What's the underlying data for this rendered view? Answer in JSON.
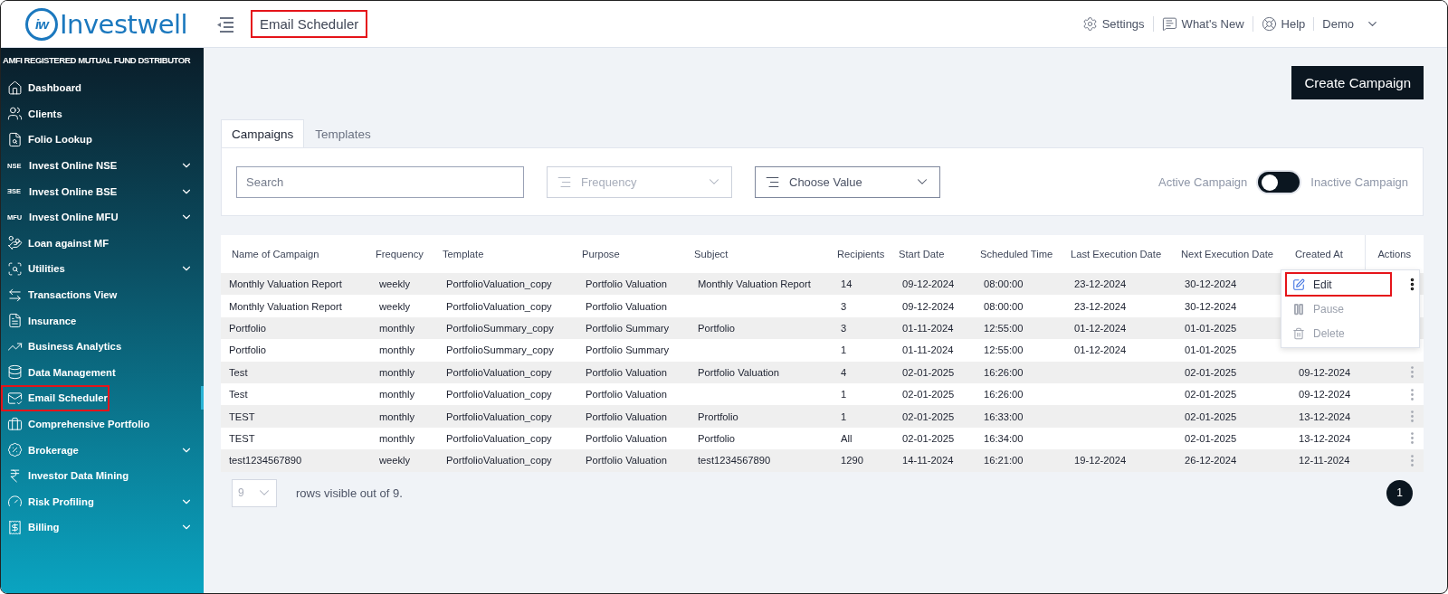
{
  "header": {
    "logo": {
      "mark": "iw",
      "name": "Investwell"
    },
    "title": {
      "text": "Email Scheduler",
      "highlighted": true
    },
    "links": [
      {
        "kind": "settings",
        "label": "Settings"
      },
      {
        "kind": "news",
        "label": "What's New"
      },
      {
        "kind": "help",
        "label": "Help"
      },
      {
        "kind": "user",
        "label": "Demo"
      }
    ]
  },
  "sidebar": {
    "heading": "AMFI REGISTERED MUTUAL FUND DSTRIBUTOR",
    "items": [
      {
        "label": "Dashboard",
        "kind": "icon",
        "expandable": false,
        "selected": false,
        "highlighted": false
      },
      {
        "label": "Clients",
        "kind": "icon",
        "expandable": false,
        "selected": false,
        "highlighted": false
      },
      {
        "label": "Folio Lookup",
        "kind": "icon",
        "expandable": false,
        "selected": false,
        "highlighted": false
      },
      {
        "label": "Invest Online NSE",
        "kind": "badge",
        "badge": "NSE",
        "expandable": true,
        "selected": false,
        "highlighted": false
      },
      {
        "label": "Invest Online BSE",
        "kind": "badge",
        "badge": "ƎSE",
        "expandable": true,
        "selected": false,
        "highlighted": false
      },
      {
        "label": "Invest Online MFU",
        "kind": "badge",
        "badge": "MFU",
        "expandable": true,
        "selected": false,
        "highlighted": false
      },
      {
        "label": "Loan against MF",
        "kind": "icon",
        "expandable": false,
        "selected": false,
        "highlighted": false
      },
      {
        "label": "Utilities",
        "kind": "icon",
        "expandable": true,
        "selected": false,
        "highlighted": false
      },
      {
        "label": "Transactions View",
        "kind": "icon",
        "expandable": false,
        "selected": false,
        "highlighted": false
      },
      {
        "label": "Insurance",
        "kind": "icon",
        "expandable": false,
        "selected": false,
        "highlighted": false
      },
      {
        "label": "Business Analytics",
        "kind": "icon",
        "expandable": false,
        "selected": false,
        "highlighted": false
      },
      {
        "label": "Data Management",
        "kind": "icon",
        "expandable": false,
        "selected": false,
        "highlighted": false
      },
      {
        "label": "Email Scheduler",
        "kind": "icon",
        "expandable": false,
        "selected": true,
        "highlighted": true
      },
      {
        "label": "Comprehensive Portfolio",
        "kind": "icon",
        "expandable": false,
        "selected": false,
        "highlighted": false
      },
      {
        "label": "Brokerage",
        "kind": "icon",
        "expandable": true,
        "selected": false,
        "highlighted": false
      },
      {
        "label": "Investor Data Mining",
        "kind": "icon",
        "expandable": false,
        "selected": false,
        "highlighted": false
      },
      {
        "label": "Risk Profiling",
        "kind": "icon",
        "expandable": true,
        "selected": false,
        "highlighted": false
      },
      {
        "label": "Billing",
        "kind": "icon",
        "expandable": true,
        "selected": false,
        "highlighted": false
      }
    ]
  },
  "create_button": "Create Campaign",
  "tabs": [
    {
      "label": "Campaigns",
      "selected": true
    },
    {
      "label": "Templates",
      "selected": false
    }
  ],
  "filters": {
    "search": {
      "placeholder": "Search"
    },
    "frequency": {
      "placeholder": "Frequency",
      "disabled": true
    },
    "value": {
      "placeholder": "Choose Value",
      "disabled": false
    },
    "toggle": {
      "left_label": "Active Campaign",
      "right_label": "Inactive Campaign",
      "on": false
    }
  },
  "table": {
    "columns": [
      "Name of Campaign",
      "Frequency",
      "Template",
      "Purpose",
      "Subject",
      "Recipients",
      "Start Date",
      "Scheduled Time",
      "Last Execution Date",
      "Next Execution Date",
      "Created At",
      "Actions"
    ],
    "rows": [
      {
        "cells": [
          "Monthly Valuation Report",
          "weekly",
          "PortfolioValuation_copy",
          "Portfolio Valuation",
          "Monthly Valuation Report",
          "14",
          "09-12-2024",
          "08:00:00",
          "23-12-2024",
          "30-12-2024",
          null
        ],
        "menu_open": true
      },
      {
        "cells": [
          "Monthly Valuation Report",
          "weekly",
          "PortfolioValuation_copy",
          "Portfolio Valuation",
          null,
          "3",
          "09-12-2024",
          "08:00:00",
          "23-12-2024",
          "30-12-2024",
          null
        ],
        "menu_open": false
      },
      {
        "cells": [
          "Portfolio",
          "monthly",
          "PortfolioSummary_copy",
          "Portfolio Summary",
          "Portfolio",
          "3",
          "01-11-2024",
          "12:55:00",
          "01-12-2024",
          "01-01-2025",
          null
        ],
        "menu_open": false
      },
      {
        "cells": [
          "Portfolio",
          "monthly",
          "PortfolioSummary_copy",
          "Portfolio Summary",
          null,
          "1",
          "01-11-2024",
          "12:55:00",
          "01-12-2024",
          "01-01-2025",
          null
        ],
        "menu_open": false
      },
      {
        "cells": [
          "Test",
          "monthly",
          "PortfolioValuation_copy",
          "Portfolio Valuation",
          "Portfolio Valuation",
          "4",
          "02-01-2025",
          "16:26:00",
          null,
          "02-01-2025",
          "09-12-2024"
        ],
        "menu_open": false
      },
      {
        "cells": [
          "Test",
          "monthly",
          "PortfolioValuation_copy",
          "Portfolio Valuation",
          null,
          "1",
          "02-01-2025",
          "16:26:00",
          null,
          "02-01-2025",
          "09-12-2024"
        ],
        "menu_open": false
      },
      {
        "cells": [
          "TEST",
          "monthly",
          "PortfolioValuation_copy",
          "Portfolio Valuation",
          "Prortfolio",
          "1",
          "02-01-2025",
          "16:33:00",
          null,
          "02-01-2025",
          "13-12-2024"
        ],
        "menu_open": false
      },
      {
        "cells": [
          "TEST",
          "monthly",
          "PortfolioValuation_copy",
          "Portfolio Valuation",
          "Portfolio",
          "All",
          "02-01-2025",
          "16:34:00",
          null,
          "02-01-2025",
          "13-12-2024"
        ],
        "menu_open": false
      },
      {
        "cells": [
          "test1234567890",
          "weekly",
          "PortfolioValuation_copy",
          "Portfolio Valuation",
          "test1234567890",
          "1290",
          "14-11-2024",
          "16:21:00",
          "19-12-2024",
          "26-12-2024",
          "12-11-2024"
        ],
        "menu_open": false
      }
    ],
    "menu": [
      {
        "kind": "edit",
        "label": "Edit",
        "disabled": false,
        "highlighted": true
      },
      {
        "kind": "pause",
        "label": "Pause",
        "disabled": true,
        "highlighted": false
      },
      {
        "kind": "delete",
        "label": "Delete",
        "disabled": true,
        "highlighted": false
      }
    ]
  },
  "footer": {
    "page_size": "9",
    "summary": "rows visible out of 9.",
    "page": "1"
  }
}
